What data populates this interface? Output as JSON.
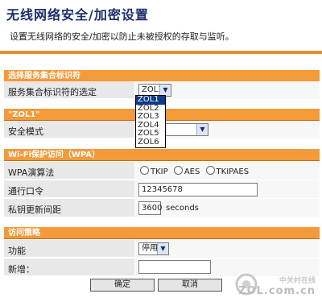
{
  "header": {
    "title": "无线网络安全/加密设置",
    "subtitle": "设置无线网络的安全/加密以防止未被授权的存取与监听。"
  },
  "ssid_section": {
    "heading": "选择服务集合标识符",
    "select_label": "服务集合标识符的选定",
    "select_value": "ZOL1",
    "options": [
      "ZOL1",
      "ZOL2",
      "ZOL3",
      "ZOL4",
      "ZOL5",
      "ZOL6"
    ],
    "highlighted_option": "ZOL1"
  },
  "zol1_section": {
    "heading": "\"ZOL1\"",
    "security_mode_label": "安全模式",
    "security_mode_value": ""
  },
  "wpa_section": {
    "heading": "Wi-Fi保护访问（WPA）",
    "algorithm_label": "WPA演算法",
    "algorithm_options": [
      "TKIP",
      "AES",
      "TKIPAES"
    ],
    "passphrase_label": "通行口令",
    "passphrase_value": "12345678",
    "rekey_label": "私钥更新间距",
    "rekey_value": "3600",
    "rekey_unit": "seconds"
  },
  "access_section": {
    "heading": "访问策略",
    "function_label": "功能",
    "function_value": "停用",
    "add_label": "新增：",
    "add_value": ""
  },
  "buttons": {
    "ok": "确定",
    "cancel": "取消"
  },
  "watermark": {
    "name": "中关村在线",
    "url": "ZOL.com.cn"
  },
  "colors": {
    "section_header": "#f39a3a",
    "title": "#1c2f6b",
    "row_bg": "#e8e8e8"
  }
}
